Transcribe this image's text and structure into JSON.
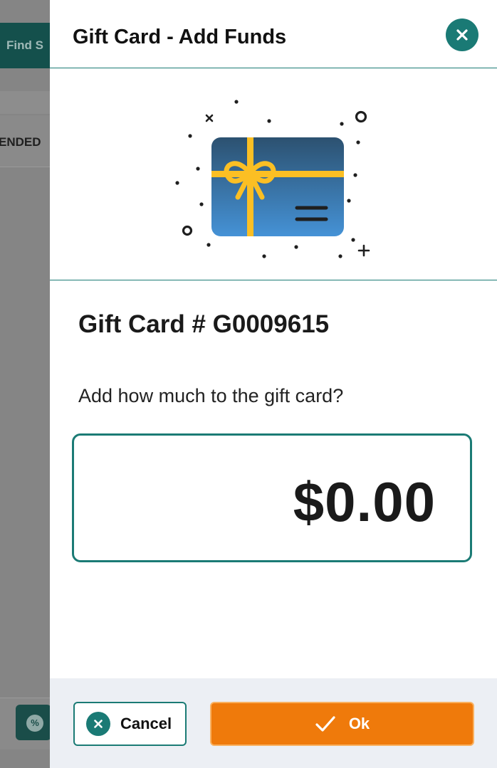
{
  "background": {
    "find_button_label": "Find S",
    "row_text": "ENDED",
    "discount_icon": "percent-badge-icon"
  },
  "modal": {
    "title": "Gift Card - Add Funds",
    "close_icon": "close-icon",
    "illustration": "gift-card-icon",
    "card_number": "Gift Card # G0009615",
    "prompt": "Add how much to the gift card?",
    "amount": "$0.00",
    "cancel_label": "Cancel",
    "ok_label": "Ok"
  },
  "colors": {
    "teal": "#1a7a75",
    "orange": "#ef7a0b",
    "gold": "#fbbf24",
    "card_blue": "#3b82c4"
  }
}
